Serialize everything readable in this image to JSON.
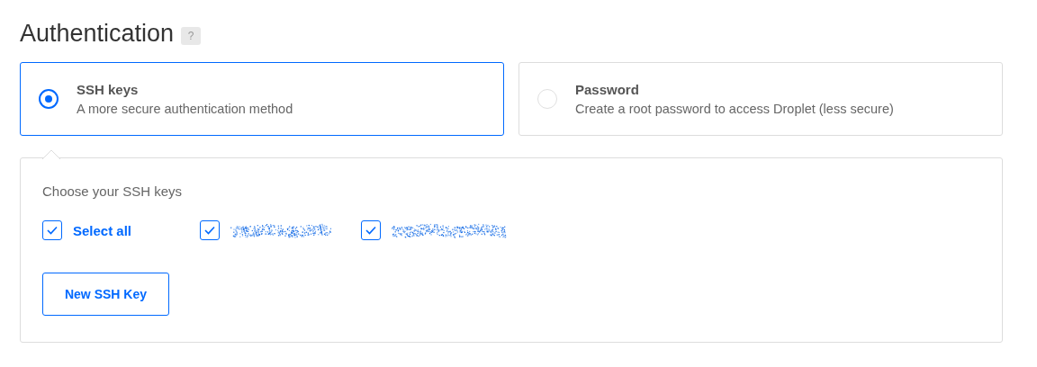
{
  "title": "Authentication",
  "help": "?",
  "methods": [
    {
      "label": "SSH keys",
      "description": "A more secure authentication method",
      "selected": true
    },
    {
      "label": "Password",
      "description": "Create a root password to access Droplet (less secure)",
      "selected": false
    }
  ],
  "ssh_panel": {
    "heading": "Choose your SSH keys",
    "keys": [
      {
        "kind": "select_all",
        "label": "Select all",
        "checked": true
      },
      {
        "kind": "redacted",
        "checked": true
      },
      {
        "kind": "redacted",
        "checked": true
      }
    ],
    "button": "New SSH Key"
  }
}
